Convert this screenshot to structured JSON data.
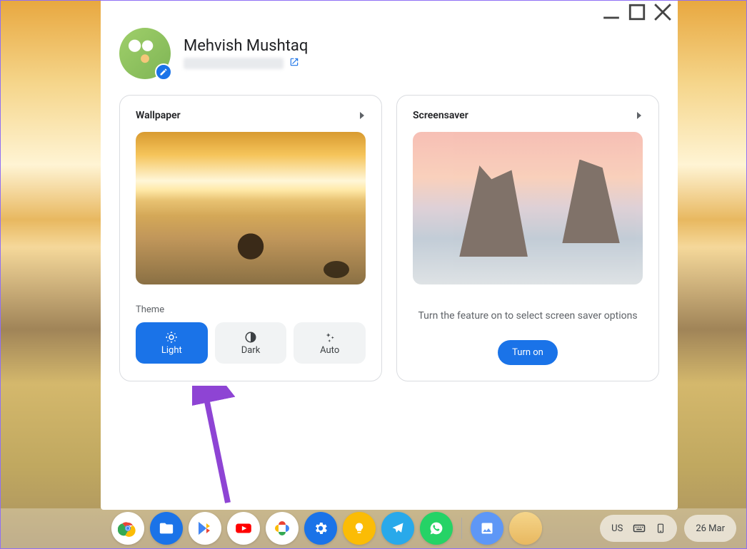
{
  "user": {
    "name": "Mehvish Mushtaq"
  },
  "wallpaper_card": {
    "title": "Wallpaper",
    "theme_label": "Theme",
    "theme_options": {
      "light": "Light",
      "dark": "Dark",
      "auto": "Auto"
    }
  },
  "screensaver_card": {
    "title": "Screensaver",
    "description": "Turn the feature on to select screen saver options",
    "turn_on_label": "Turn on"
  },
  "shelf": {
    "ime": "US",
    "date": "26 Mar"
  }
}
